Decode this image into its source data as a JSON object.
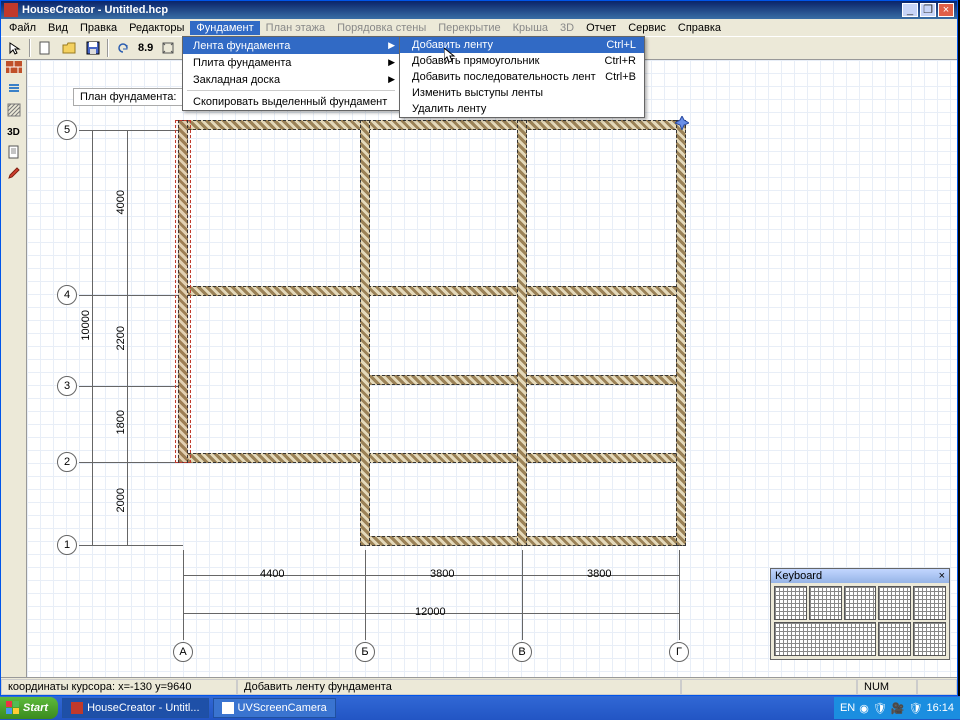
{
  "title": "HouseCreator - Untitled.hcp",
  "menubar": [
    "Файл",
    "Вид",
    "Правка",
    "Редакторы",
    "Фундамент",
    "План этажа",
    "Порядовка стены",
    "Перекрытие",
    "Крыша",
    "3D",
    "Отчет",
    "Сервис",
    "Справка"
  ],
  "menubar_disabled": [
    5,
    6,
    7,
    8,
    9
  ],
  "menubar_open": 4,
  "toolbar_zoom": "8.9",
  "menu1": {
    "items": [
      {
        "label": "Лента фундамента",
        "arrow": true,
        "hi": true
      },
      {
        "label": "Плита фундамента",
        "arrow": true
      },
      {
        "label": "Закладная доска",
        "arrow": true
      },
      {
        "label": "Скопировать выделенный фундамент"
      }
    ]
  },
  "menu2": {
    "items": [
      {
        "label": "Добавить ленту",
        "shortcut": "Ctrl+L",
        "hi": true
      },
      {
        "label": "Добавить прямоугольник",
        "shortcut": "Ctrl+R"
      },
      {
        "label": "Добавить последовательность лент",
        "shortcut": "Ctrl+B"
      },
      {
        "label": "Изменить выступы ленты"
      },
      {
        "label": "Удалить ленту"
      }
    ]
  },
  "plan_label": "План фундамента:",
  "axis_v": [
    "5",
    "4",
    "3",
    "2",
    "1"
  ],
  "axis_h": [
    "А",
    "Б",
    "В",
    "Г"
  ],
  "dims_v": [
    "4000",
    "2200",
    "1800",
    "2000",
    "10000"
  ],
  "dims_h": [
    "4400",
    "3800",
    "3800",
    "12000"
  ],
  "status": {
    "coords": "координаты курсора: x=-130 y=9640",
    "hint": "Добавить ленту фундамента",
    "num": "NUM"
  },
  "sidebar_labels": [
    "3D"
  ],
  "keyboard_title": "Keyboard",
  "taskbar": {
    "start": "Start",
    "items": [
      "HouseCreator - Untitl...",
      "UVScreenCamera"
    ],
    "lang": "EN",
    "time": "16:14"
  }
}
